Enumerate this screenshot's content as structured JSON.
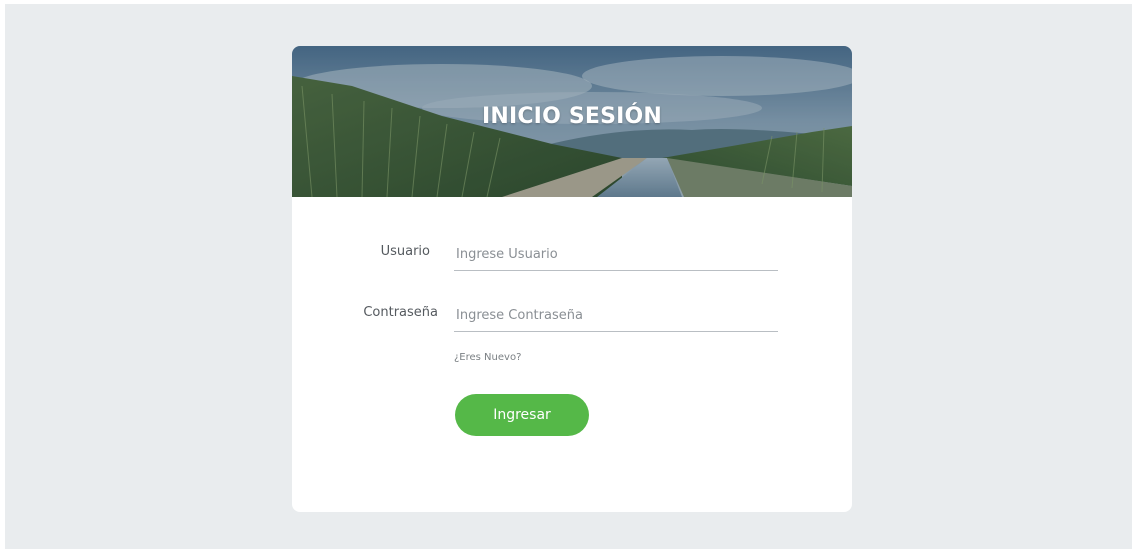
{
  "colors": {
    "page_background": "#e9ecee",
    "card_background": "#ffffff",
    "primary_button": "#55b848",
    "input_underline": "#b9bec3"
  },
  "banner": {
    "title": "INICIO SESIÓN",
    "image": "sugarcane-field-with-irrigation-canal"
  },
  "form": {
    "username": {
      "label": "Usuario",
      "placeholder": "Ingrese Usuario",
      "value": ""
    },
    "password": {
      "label": "Contraseña",
      "placeholder": "Ingrese Contraseña",
      "value": ""
    },
    "register_link": "¿Eres Nuevo?",
    "submit_label": "Ingresar"
  }
}
